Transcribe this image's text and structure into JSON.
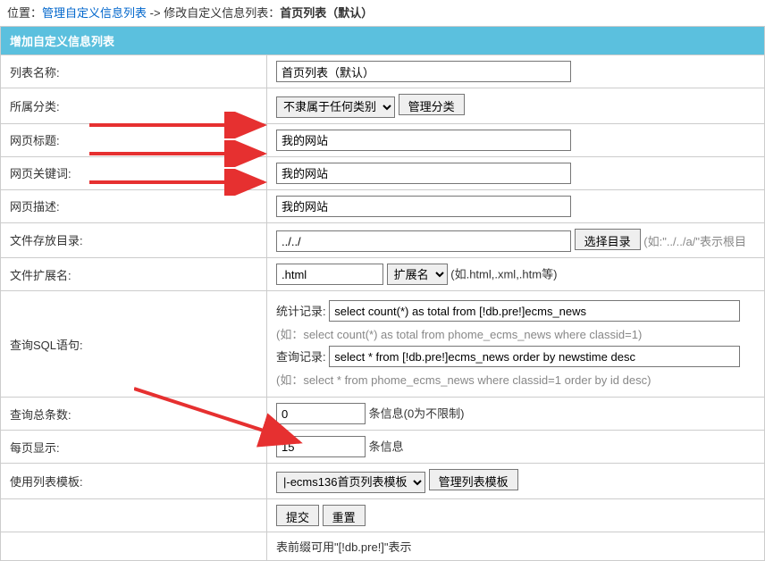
{
  "breadcrumb": {
    "label_position": "位置：",
    "link_text": "管理自定义信息列表",
    "separator": " -> ",
    "action_text": "修改自定义信息列表：",
    "current_bold": "首页列表（默认）"
  },
  "header": {
    "title": "增加自定义信息列表"
  },
  "rows": {
    "list_name": {
      "label": "列表名称:",
      "value": "首页列表（默认）"
    },
    "category": {
      "label": "所属分类:",
      "selected": "不隶属于任何类别",
      "manage_btn": "管理分类"
    },
    "page_title": {
      "label": "网页标题:",
      "value": "我的网站"
    },
    "page_keywords": {
      "label": "网页关键词:",
      "value": "我的网站"
    },
    "page_desc": {
      "label": "网页描述:",
      "value": "我的网站"
    },
    "file_dir": {
      "label": "文件存放目录:",
      "value": "../../",
      "select_btn": "选择目录",
      "hint": "(如:\"../../a/\"表示根目"
    },
    "file_ext": {
      "label": "文件扩展名:",
      "value": ".html",
      "ext_select": "扩展名",
      "hint": "(如.html,.xml,.htm等)"
    },
    "sql": {
      "label": "查询SQL语句:",
      "count_label": "统计记录:",
      "count_value": "select count(*) as total from [!db.pre!]ecms_news",
      "count_hint": "(如：select count(*) as total from phome_ecms_news where classid=1)",
      "query_label": "查询记录:",
      "query_value": "select * from [!db.pre!]ecms_news order by newstime desc",
      "query_hint": "(如：select * from phome_ecms_news where classid=1 order by id desc)"
    },
    "total_count": {
      "label": "查询总条数:",
      "value": "0",
      "suffix": "条信息(0为不限制)"
    },
    "per_page": {
      "label": "每页显示:",
      "value": "15",
      "suffix": "条信息"
    },
    "template": {
      "label": "使用列表模板:",
      "selected": "|-ecms136首页列表模板",
      "manage_btn": "管理列表模板"
    },
    "actions": {
      "submit": "提交",
      "reset": "重置"
    },
    "footer_hint": "表前缀可用\"[!db.pre!]\"表示"
  }
}
